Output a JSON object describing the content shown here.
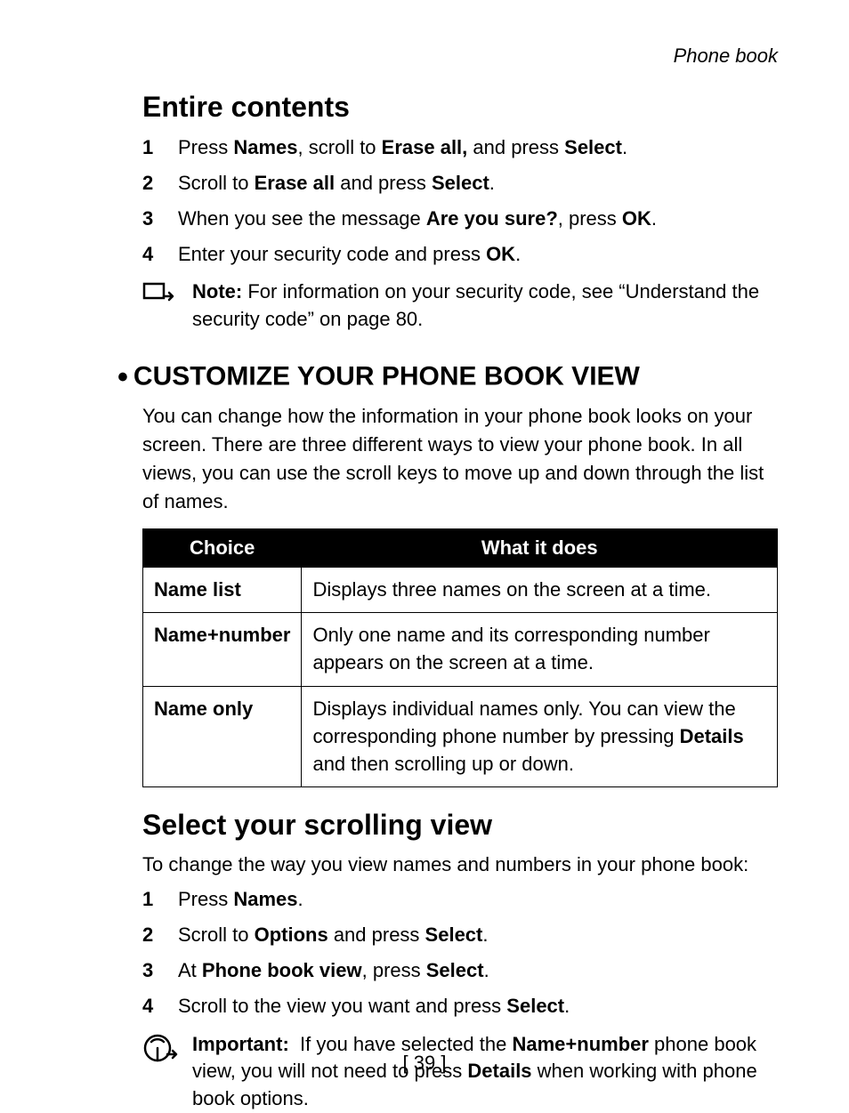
{
  "running_head": "Phone book",
  "section1": {
    "title": "Entire contents",
    "steps": [
      {
        "n": "1",
        "html": "Press <strong>Names</strong>, scroll to <strong>Erase all,</strong> and press <strong>Select</strong>."
      },
      {
        "n": "2",
        "html": "Scroll to <strong>Erase all</strong> and press <strong>Select</strong>."
      },
      {
        "n": "3",
        "html": "When you see the message <strong>Are you sure?</strong>, press <strong>OK</strong>."
      },
      {
        "n": "4",
        "html": "Enter your security code and press <strong>OK</strong>."
      }
    ],
    "note_html": "<strong>Note:</strong> For information on your security code, see “Understand the security code” on page 80."
  },
  "section2": {
    "title": "CUSTOMIZE YOUR PHONE BOOK VIEW",
    "intro": "You can change how the information in your phone book looks on your screen. There are three different ways to view your phone book. In all views, you can use the scroll keys to move up and down through the list of names.",
    "table": {
      "headers": [
        "Choice",
        "What it does"
      ],
      "rows": [
        {
          "choice": "Name list",
          "desc_html": "Displays three names on the screen at a time."
        },
        {
          "choice": "Name+number",
          "desc_html": "Only one name and its corresponding number appears on the screen at a time."
        },
        {
          "choice": "Name only",
          "desc_html": "Displays individual names only. You can view the corresponding phone number by pressing <strong>Details</strong> and then scrolling up or down."
        }
      ]
    }
  },
  "section3": {
    "title": "Select your scrolling view",
    "intro": "To change the way you view names and numbers in your phone book:",
    "steps": [
      {
        "n": "1",
        "html": "Press <strong>Names</strong>."
      },
      {
        "n": "2",
        "html": "Scroll to <strong>Options</strong> and press <strong>Select</strong>."
      },
      {
        "n": "3",
        "html": "At <strong>Phone book view</strong>, press <strong>Select</strong>."
      },
      {
        "n": "4",
        "html": "Scroll to the view you want and press <strong>Select</strong>."
      }
    ],
    "important_html": "<strong>Important:</strong>  If you have selected the <strong>Name+number</strong> phone book view, you will not need to press <strong>Details</strong> when working with phone book options."
  },
  "page_number": "[ 39 ]"
}
